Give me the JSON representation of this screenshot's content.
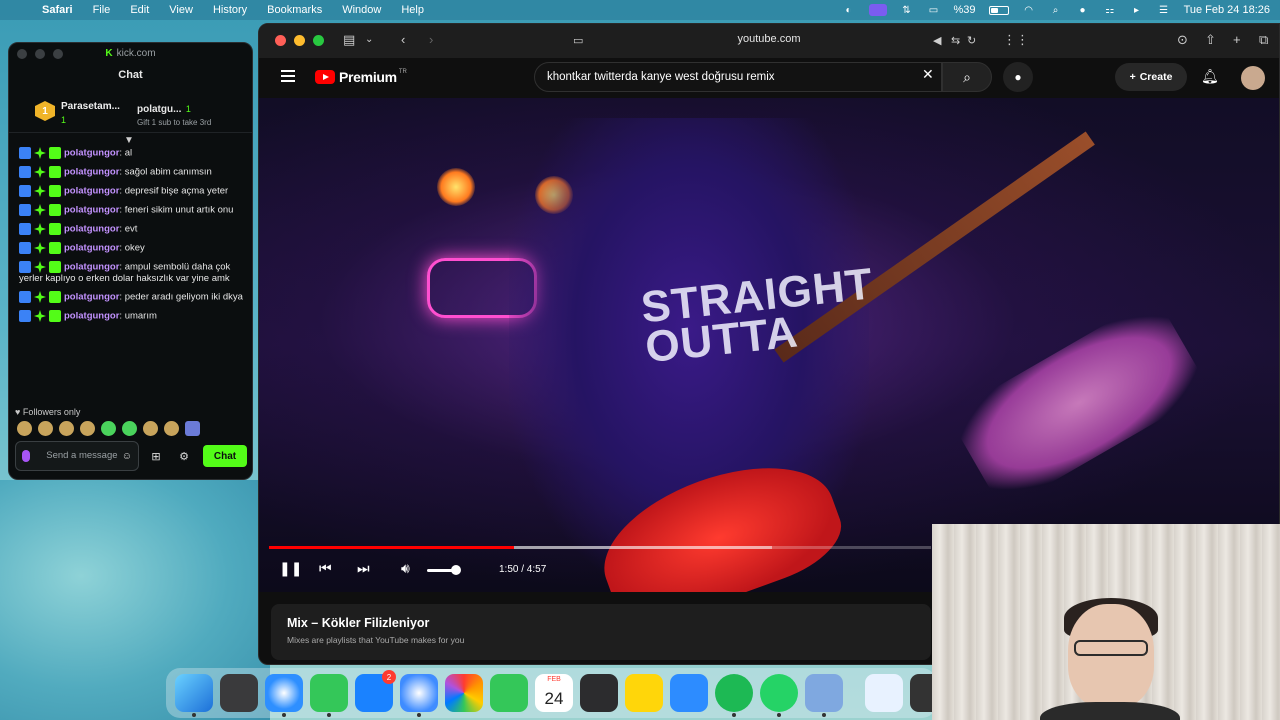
{
  "menubar": {
    "app_name": "Safari",
    "items": [
      "File",
      "Edit",
      "View",
      "History",
      "Bookmarks",
      "Window",
      "Help"
    ],
    "battery": "%39",
    "datetime": "Tue Feb 24  18:26"
  },
  "kick": {
    "url": "kick.com",
    "chat_title": "Chat",
    "leader1": {
      "rank": "1",
      "name": "Parasetam...",
      "count": "1"
    },
    "leader2": {
      "name": "polatgu...",
      "count": "1",
      "sub": "Gift 1 sub to take 3rd"
    },
    "messages": [
      {
        "user": "polatgungor",
        "text": "al"
      },
      {
        "user": "polatgungor",
        "text": "sağol abim canımsın"
      },
      {
        "user": "polatgungor",
        "text": "depresif bişe açma yeter"
      },
      {
        "user": "polatgungor",
        "text": "feneri sikim unut artık onu"
      },
      {
        "user": "polatgungor",
        "text": "evt"
      },
      {
        "user": "polatgungor",
        "text": "okey"
      },
      {
        "user": "polatgungor",
        "text": "ampul sembolü daha çok yerler kaplıyo o erken dolar haksızlık var yine amk"
      },
      {
        "user": "polatgungor",
        "text": "peder aradı geliyom iki dkya"
      },
      {
        "user": "polatgungor",
        "text": "umarım"
      }
    ],
    "followers_only": "Followers only",
    "input_placeholder": "Send a message",
    "chat_button": "Chat"
  },
  "safari": {
    "address": "youtube.com"
  },
  "youtube": {
    "brand": "Premium",
    "brand_sup": "TR",
    "search_value": "khontkar twitterda kanye west doğrusu remix",
    "create_label": "Create",
    "player": {
      "current_time": "1:50",
      "duration": "4:57",
      "time_display": "1:50 / 4:57",
      "progress_fraction": 0.37,
      "buffer_fraction": 0.76,
      "shirt_text": "STRAIGHT OUTTA"
    },
    "mix": {
      "title": "Mix – Kökler Filizleniyor",
      "subtitle": "Mixes are playlists that YouTube makes for you"
    }
  },
  "dock": {
    "mail_badge": "2",
    "calendar_month": "FEB",
    "calendar_day": "24"
  },
  "colors": {
    "kick_green": "#53fc18",
    "youtube_red": "#ff0000",
    "chat_username": "#c392ff"
  }
}
